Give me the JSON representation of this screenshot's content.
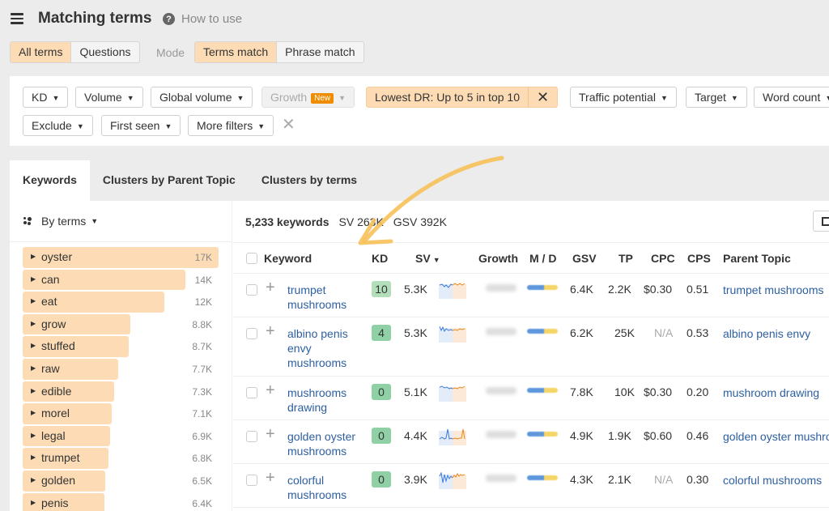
{
  "header": {
    "title": "Matching terms",
    "help_label": "How to use",
    "help_icon": "question-circle-icon",
    "menu_icon": "hamburger-icon"
  },
  "terms_toggle": {
    "options": [
      "All terms",
      "Questions"
    ],
    "selected": "All terms"
  },
  "mode": {
    "label": "Mode",
    "options": [
      "Terms match",
      "Phrase match"
    ],
    "selected": "Terms match"
  },
  "filters": {
    "row1": [
      "KD",
      "Volume",
      "Global volume"
    ],
    "growth": {
      "label": "Growth",
      "badge": "New"
    },
    "active_filter": "Lowest DR: Up to 5 in top 10",
    "row1_more": [
      "Traffic potential",
      "Target",
      "Word count"
    ],
    "row2": [
      "Exclude",
      "First seen",
      "More filters"
    ],
    "clear_icon": "close-icon"
  },
  "tabs": [
    "Keywords",
    "Clusters by Parent Topic",
    "Clusters by terms"
  ],
  "active_tab": "Keywords",
  "sidebar": {
    "group_by_label": "By terms",
    "terms": [
      {
        "name": "oyster",
        "count": "17K",
        "value": 17000
      },
      {
        "name": "can",
        "count": "14K",
        "value": 14000
      },
      {
        "name": "eat",
        "count": "12K",
        "value": 12000
      },
      {
        "name": "grow",
        "count": "8.8K",
        "value": 8800
      },
      {
        "name": "stuffed",
        "count": "8.7K",
        "value": 8700
      },
      {
        "name": "raw",
        "count": "7.7K",
        "value": 7700
      },
      {
        "name": "edible",
        "count": "7.3K",
        "value": 7300
      },
      {
        "name": "morel",
        "count": "7.1K",
        "value": 7100
      },
      {
        "name": "legal",
        "count": "6.9K",
        "value": 6900
      },
      {
        "name": "trumpet",
        "count": "6.8K",
        "value": 6800
      },
      {
        "name": "golden",
        "count": "6.5K",
        "value": 6500
      },
      {
        "name": "penis",
        "count": "6.4K",
        "value": 6400
      }
    ]
  },
  "summary": {
    "keywords": "5,233 keywords",
    "sv": "SV 263K",
    "gsv": "GSV 392K"
  },
  "table": {
    "columns": [
      "Keyword",
      "KD",
      "SV",
      "Growth",
      "M / D",
      "GSV",
      "TP",
      "CPC",
      "CPS",
      "Parent Topic"
    ],
    "sort_column": "SV",
    "rows": [
      {
        "keyword": "trumpet mushrooms",
        "kd": "10",
        "sv": "5.3K",
        "gsv": "6.4K",
        "tp": "2.2K",
        "cpc": "$0.30",
        "cps": "0.51",
        "parent_topic": "trumpet mushrooms"
      },
      {
        "keyword": "albino penis envy mushrooms",
        "kd": "4",
        "sv": "5.3K",
        "gsv": "6.2K",
        "tp": "25K",
        "cpc": "N/A",
        "cps": "0.53",
        "parent_topic": "albino penis envy"
      },
      {
        "keyword": "mushrooms drawing",
        "kd": "0",
        "sv": "5.1K",
        "gsv": "7.8K",
        "tp": "10K",
        "cpc": "$0.30",
        "cps": "0.20",
        "parent_topic": "mushroom drawing"
      },
      {
        "keyword": "golden oyster mushrooms",
        "kd": "0",
        "sv": "4.4K",
        "gsv": "4.9K",
        "tp": "1.9K",
        "cpc": "$0.60",
        "cps": "0.46",
        "parent_topic": "golden oyster mushrooms"
      },
      {
        "keyword": "colorful mushrooms",
        "kd": "0",
        "sv": "3.9K",
        "gsv": "4.3K",
        "tp": "2.1K",
        "cpc": "N/A",
        "cps": "0.30",
        "parent_topic": "colorful mushrooms"
      }
    ]
  },
  "colors": {
    "accent_orange": "#fddcb5",
    "link_blue": "#2d5fa0",
    "kd_green": "#8fd1a5",
    "annotation_arrow": "#f7c15a"
  }
}
